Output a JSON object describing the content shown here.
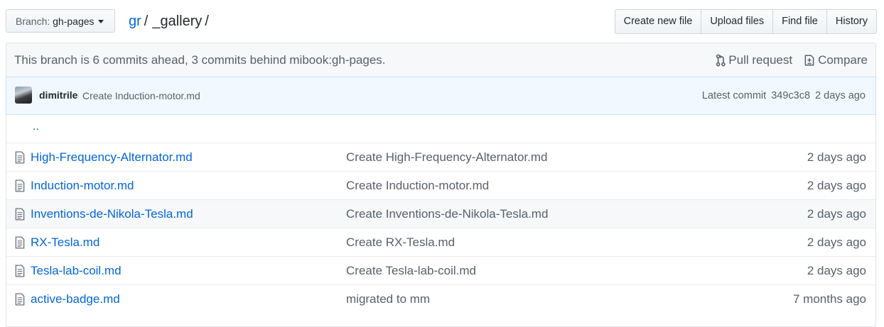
{
  "branch": {
    "prefix": "Branch:",
    "name": "gh-pages"
  },
  "breadcrumb": {
    "root": "gr",
    "sep1": "/",
    "current": "_gallery",
    "sep2": "/"
  },
  "actions": {
    "create": "Create new file",
    "upload": "Upload files",
    "find": "Find file",
    "history": "History"
  },
  "tracker": {
    "message": "This branch is 6 commits ahead, 3 commits behind mibook:gh-pages.",
    "pull_request": "Pull request",
    "compare": "Compare"
  },
  "commit": {
    "author": "dimitrile",
    "message": "Create Induction-motor.md",
    "latest_label": "Latest commit",
    "sha": "349c3c8",
    "age": "2 days ago"
  },
  "parent_link": "..",
  "files": [
    {
      "name": "High-Frequency-Alternator.md",
      "message": "Create High-Frequency-Alternator.md",
      "age": "2 days ago"
    },
    {
      "name": "Induction-motor.md",
      "message": "Create Induction-motor.md",
      "age": "2 days ago"
    },
    {
      "name": "Inventions-de-Nikola-Tesla.md",
      "message": "Create Inventions-de-Nikola-Tesla.md",
      "age": "2 days ago"
    },
    {
      "name": "RX-Tesla.md",
      "message": "Create RX-Tesla.md",
      "age": "2 days ago"
    },
    {
      "name": "Tesla-lab-coil.md",
      "message": "Create Tesla-lab-coil.md",
      "age": "2 days ago"
    },
    {
      "name": "active-badge.md",
      "message": "migrated to mm",
      "age": "7 months ago"
    }
  ]
}
